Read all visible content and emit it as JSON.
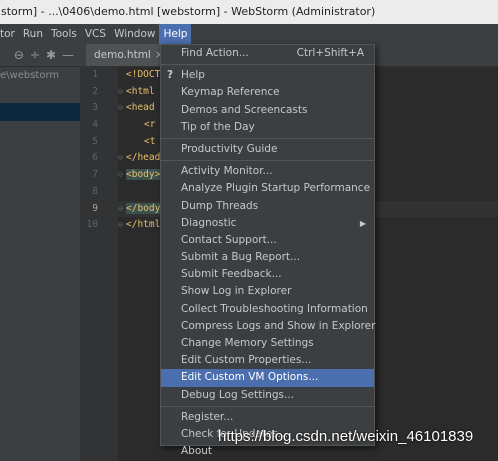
{
  "window": {
    "title": "storm] - ...\\0406\\demo.html [webstorm] - WebStorm (Administrator)"
  },
  "menubar": [
    "tor",
    "Run",
    "Tools",
    "VCS",
    "Window",
    "Help"
  ],
  "toolwindow": {
    "path": "e\\webstorm"
  },
  "editor": {
    "tab": "demo.html",
    "line_numbers": [
      "1",
      "2",
      "3",
      "4",
      "5",
      "6",
      "7",
      "8",
      "9",
      "10"
    ],
    "lines": [
      "<!DOCT",
      "<html",
      "<head",
      "<r",
      "<t",
      "</head",
      "<body>",
      "",
      "</body",
      "</html"
    ]
  },
  "help_menu": {
    "items": [
      {
        "label": "Find Action...",
        "shortcut": "Ctrl+Shift+A"
      },
      {
        "sep": true
      },
      {
        "label": "Help",
        "icon": "?"
      },
      {
        "label": "Keymap Reference"
      },
      {
        "label": "Demos and Screencasts"
      },
      {
        "label": "Tip of the Day"
      },
      {
        "sep": true
      },
      {
        "label": "Productivity Guide"
      },
      {
        "sep": true
      },
      {
        "label": "Activity Monitor..."
      },
      {
        "label": "Analyze Plugin Startup Performance"
      },
      {
        "label": "Dump Threads"
      },
      {
        "label": "Diagnostic",
        "submenu": true
      },
      {
        "label": "Contact Support..."
      },
      {
        "label": "Submit a Bug Report..."
      },
      {
        "label": "Submit Feedback..."
      },
      {
        "label": "Show Log in Explorer"
      },
      {
        "label": "Collect Troubleshooting Information"
      },
      {
        "label": "Compress Logs and Show in Explorer"
      },
      {
        "label": "Change Memory Settings"
      },
      {
        "label": "Edit Custom Properties..."
      },
      {
        "label": "Edit Custom VM Options...",
        "selected": true
      },
      {
        "label": "Debug Log Settings..."
      },
      {
        "sep": true
      },
      {
        "label": "Register..."
      },
      {
        "label": "Check for Updates..."
      },
      {
        "label": "About"
      }
    ]
  },
  "watermark": "https://blog.csdn.net/weixin_46101839",
  "colors": {
    "menu_bg": "#3c3f41",
    "selection": "#4b6eaf",
    "editor_bg": "#2b2b2b"
  }
}
